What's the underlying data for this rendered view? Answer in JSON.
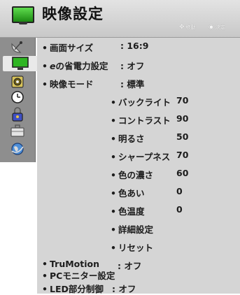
{
  "header": {
    "title": "映像設定",
    "hint_move": "移動",
    "hint_ok": "決定"
  },
  "sidebar": {
    "items": [
      {
        "icon": "satellite-dish-icon",
        "active": false
      },
      {
        "icon": "tv-screen-icon",
        "active": true
      },
      {
        "icon": "speaker-icon",
        "active": false
      },
      {
        "icon": "clock-icon",
        "active": false
      },
      {
        "icon": "lock-icon",
        "active": false
      },
      {
        "icon": "toolbox-icon",
        "active": false
      },
      {
        "icon": "globe-icon",
        "active": false
      }
    ]
  },
  "menu": {
    "screen_size": {
      "label": "画面サイズ",
      "value": ": 16:9"
    },
    "eco": {
      "label": "e",
      "label_rest": "の省電力設定",
      "value": ": オフ"
    },
    "picture_mode": {
      "label": "映像モード",
      "value": ": 標準"
    },
    "sub": [
      {
        "label": "バックライト",
        "value": "70"
      },
      {
        "label": "コントラスト",
        "value": "90"
      },
      {
        "label": "明るさ",
        "value": "50"
      },
      {
        "label": "シャープネス",
        "value": "70"
      },
      {
        "label": "色の濃さ",
        "value": "60"
      },
      {
        "label": "色あい",
        "value": "0"
      },
      {
        "label": "色温度",
        "value": "0"
      },
      {
        "label": "詳細設定",
        "value": ""
      },
      {
        "label": "リセット",
        "value": ""
      }
    ],
    "trumotion": {
      "label": "TruMotion",
      "value": ": オフ"
    },
    "pc_monitor": {
      "label": "PCモニター設定"
    },
    "led": {
      "label": "LED部分制御",
      "value": ": オフ"
    }
  }
}
